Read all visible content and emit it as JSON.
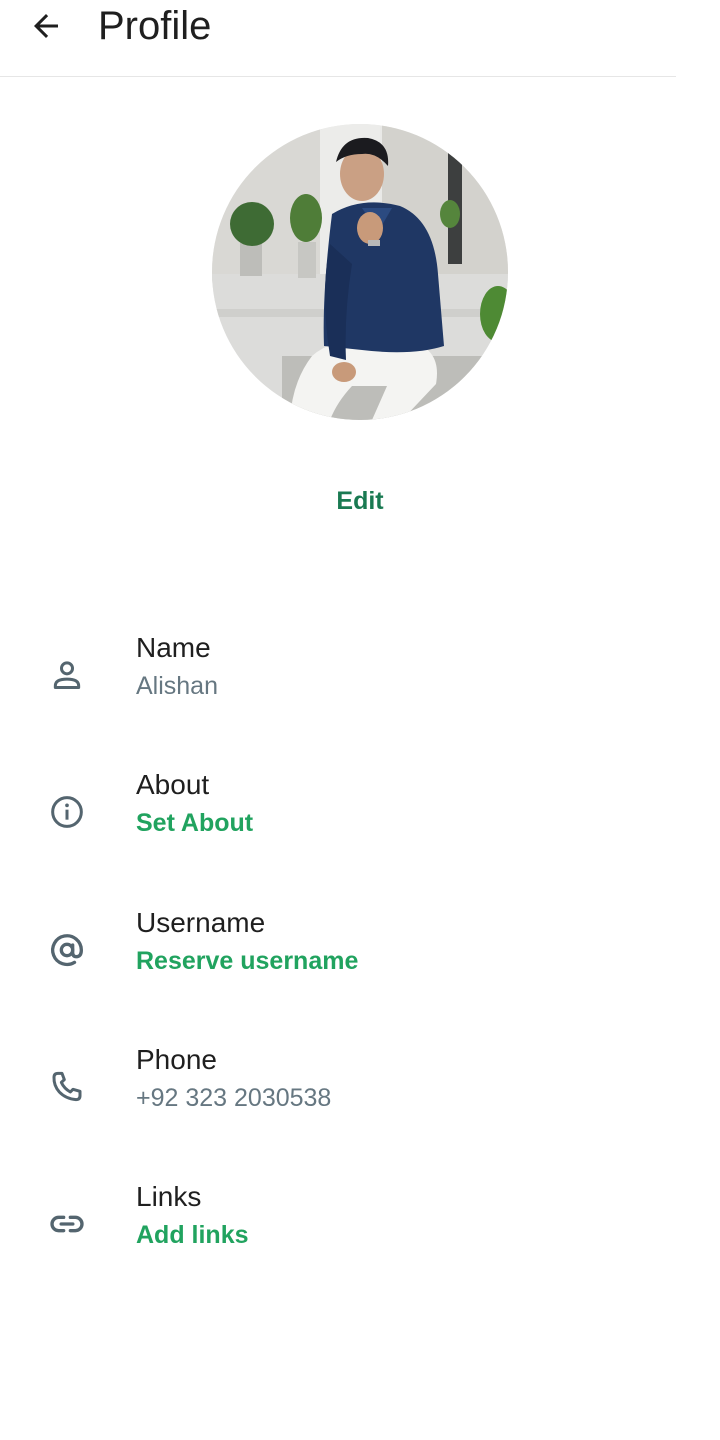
{
  "header": {
    "title": "Profile",
    "back_icon": "arrow-left-icon"
  },
  "profile": {
    "edit_label": "Edit"
  },
  "colors": {
    "accent": "#21a35f",
    "edit_accent": "#1a7a52",
    "secondary_text": "#667781",
    "icon": "#54656f"
  },
  "fields": [
    {
      "icon": "person-icon",
      "label": "Name",
      "value": "Alishan"
    },
    {
      "icon": "info-icon",
      "label": "About",
      "value": "Set About"
    },
    {
      "icon": "at-sign-icon",
      "label": "Username",
      "value": "Reserve username"
    },
    {
      "icon": "phone-icon",
      "label": "Phone",
      "value": "+92 323 2030538"
    },
    {
      "icon": "link-icon",
      "label": "Links",
      "value": "Add links"
    }
  ]
}
